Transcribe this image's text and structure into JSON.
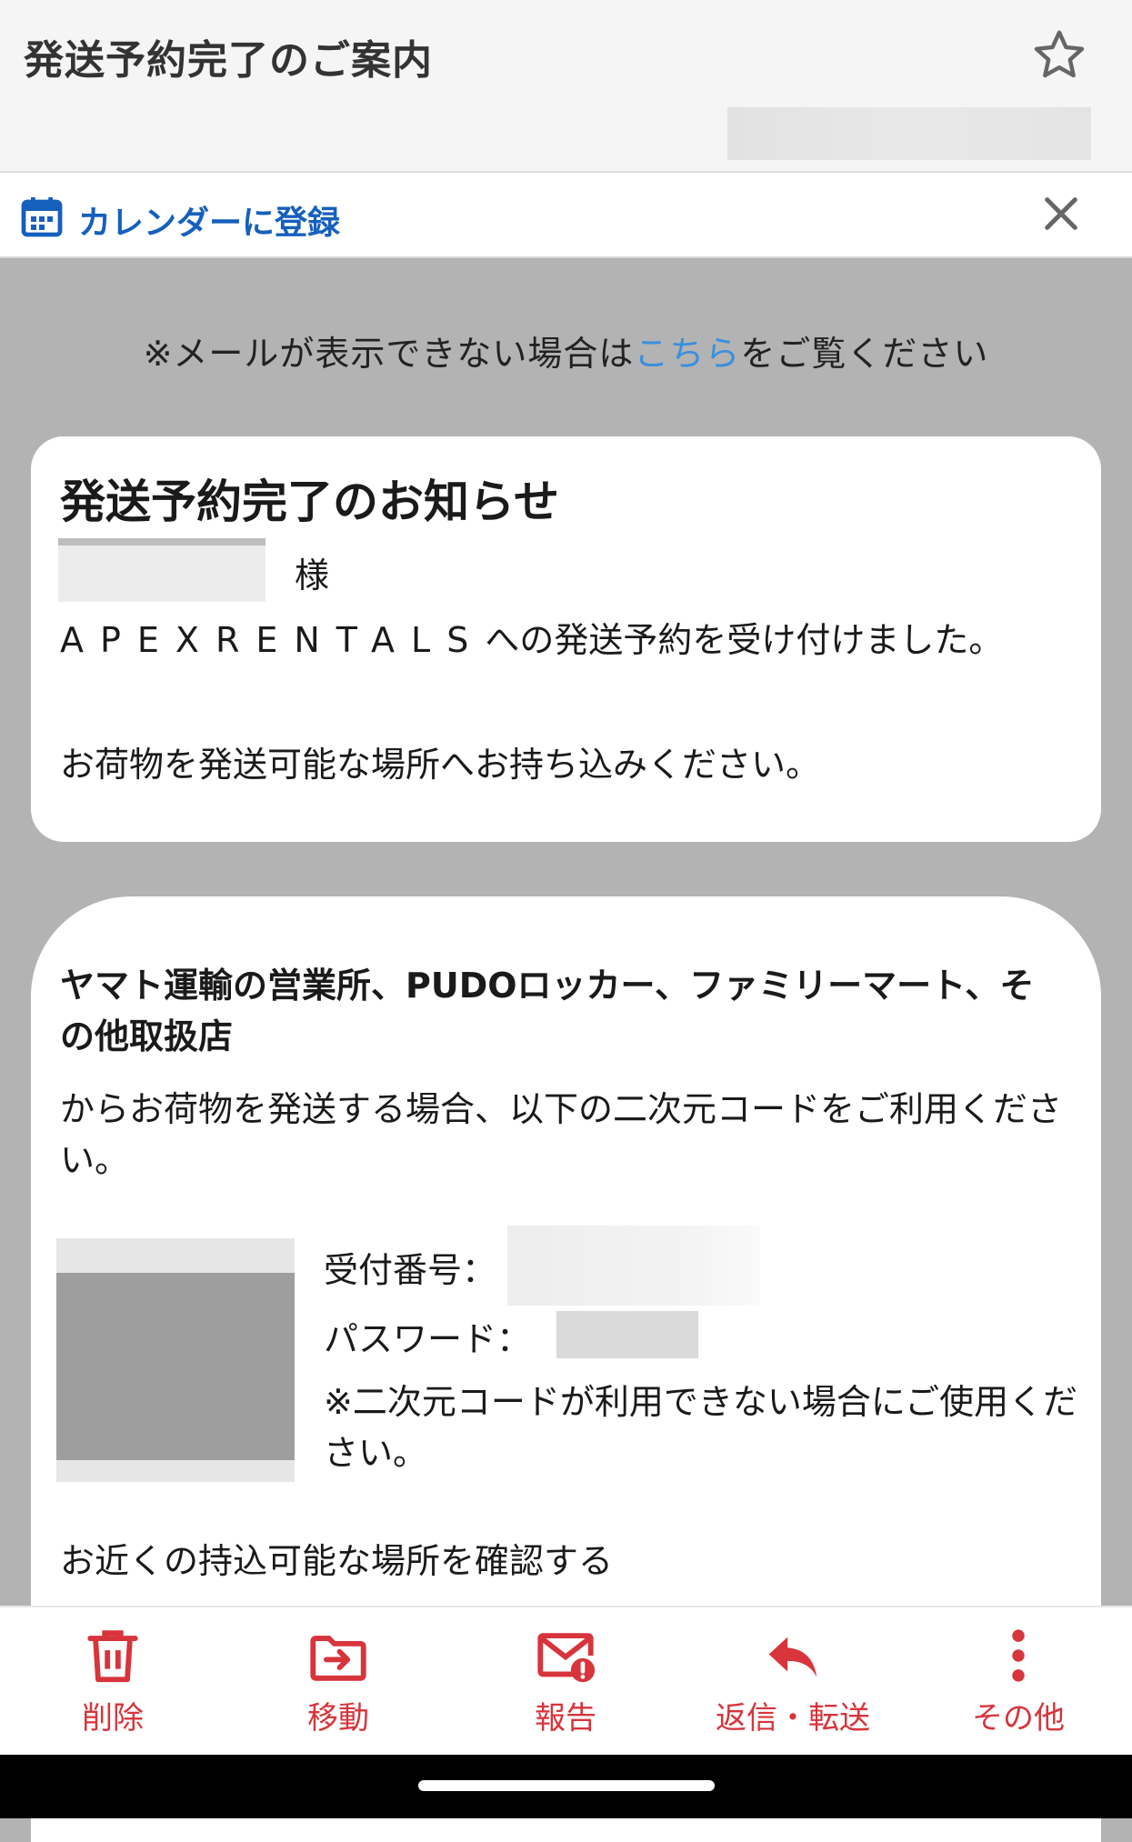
{
  "header": {
    "subject": "発送予約完了のご案内",
    "star_icon": "star-outline-icon"
  },
  "calendar_bar": {
    "icon": "calendar-icon",
    "label": "カレンダーに登録",
    "close_icon": "close-icon"
  },
  "notice": {
    "prefix": "※メールが表示できない場合は",
    "link": "こちら",
    "suffix": "をご覧ください"
  },
  "card1": {
    "title": "発送予約完了のお知らせ",
    "honorific": "様",
    "brand": "APEXRENTALS",
    "message1_rest": "への発送予約を受け付けました。",
    "message2": "お荷物を発送可能な場所へお持ち込みください。"
  },
  "card2": {
    "heading": "ヤマト運輸の営業所、PUDOロッカー、ファミリーマート、その他取扱店",
    "text": "からお荷物を発送する場合、以下の二次元コードをご利用ください。",
    "receipt_label": "受付番号：",
    "password_label": "パスワード：",
    "note": "※二次元コードが利用できない場合にご使用ください。",
    "nearby": "お近くの持込可能な場所を確認する"
  },
  "toolbar": {
    "items": [
      {
        "label": "削除",
        "icon": "trash-icon"
      },
      {
        "label": "移動",
        "icon": "move-folder-icon"
      },
      {
        "label": "報告",
        "icon": "report-mail-icon"
      },
      {
        "label": "返信・転送",
        "icon": "reply-icon"
      },
      {
        "label": "その他",
        "icon": "more-vertical-icon"
      }
    ]
  },
  "colors": {
    "accent_red": "#d7343b",
    "link_blue": "#3a8fde",
    "calendar_blue": "#1560bd",
    "background_gray": "#b3b3b3"
  }
}
